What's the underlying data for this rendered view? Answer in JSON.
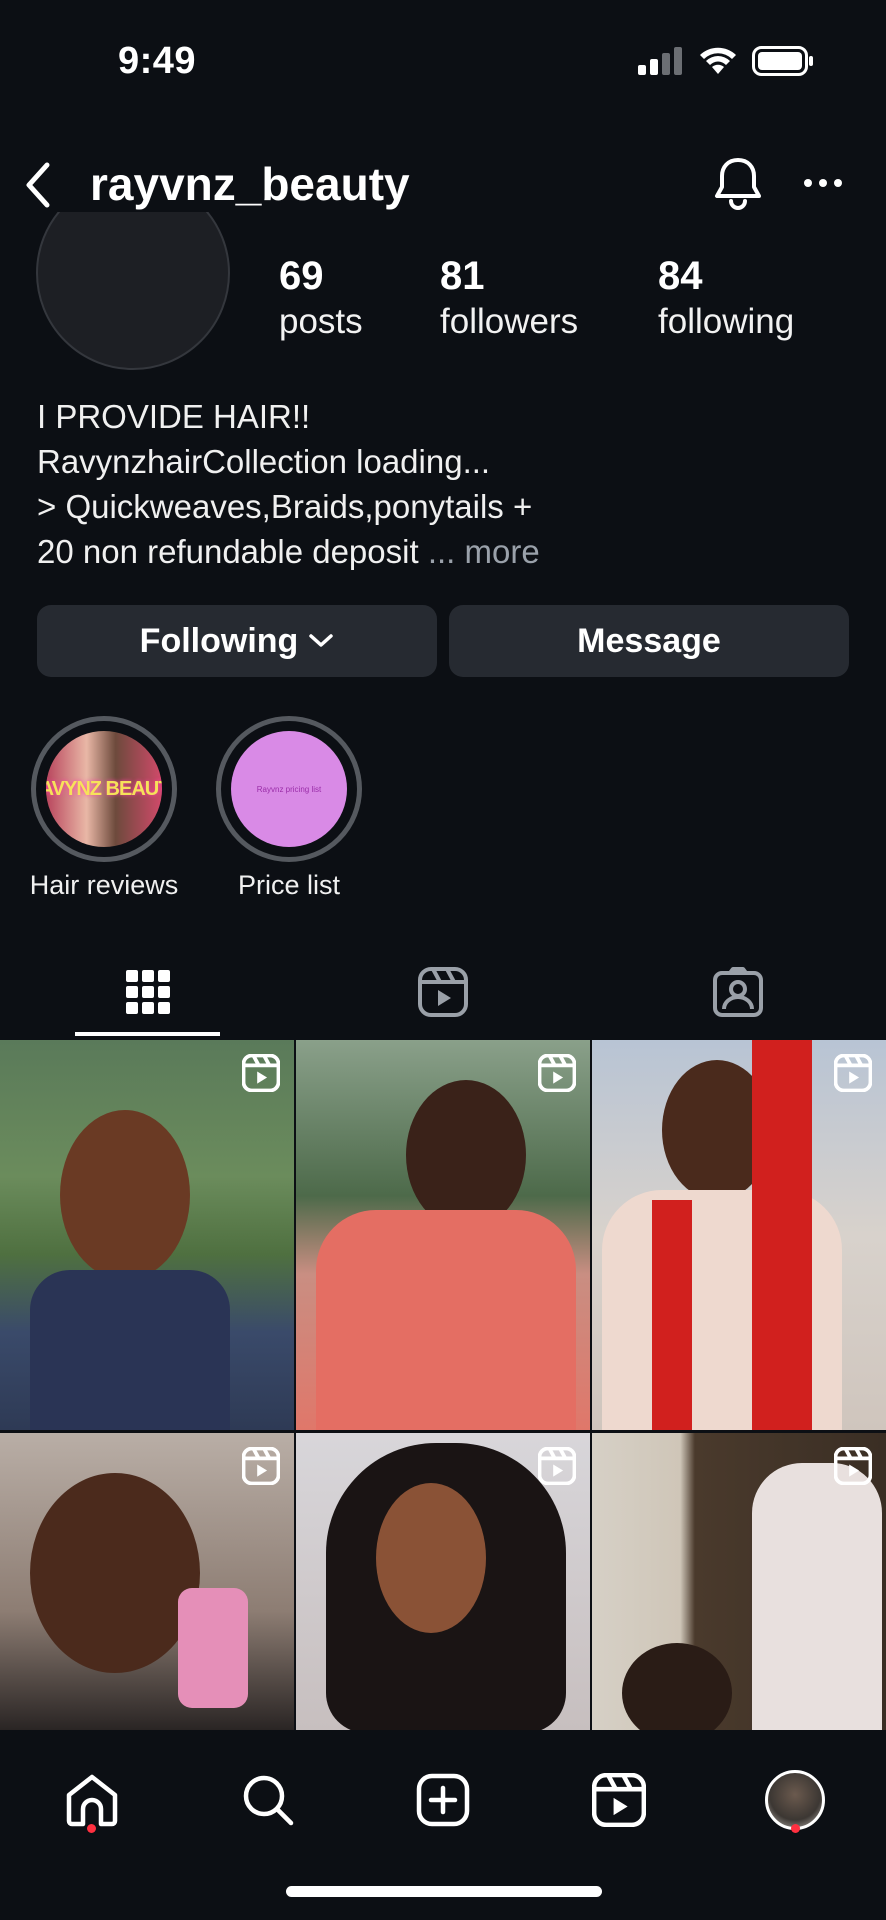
{
  "status_bar": {
    "time": "9:49"
  },
  "header": {
    "username": "rayvnz_beauty"
  },
  "profile": {
    "stats": [
      {
        "value": "69",
        "label": "posts"
      },
      {
        "value": "81",
        "label": "followers"
      },
      {
        "value": "84",
        "label": "following"
      }
    ],
    "bio_lines": [
      "I PROVIDE HAIR!!",
      "RavynzhairCollection loading...",
      "> Quickweaves,Braids,ponytails +",
      "20 non refundable deposit"
    ],
    "bio_ellipsis": "...",
    "bio_more": "more"
  },
  "actions": {
    "following_label": "Following",
    "message_label": "Message"
  },
  "highlights": [
    {
      "label": "Hair reviews",
      "cover_text": "RAVYNZ BEAUTY"
    },
    {
      "label": "Price list",
      "cover_text": "Rayvnz pricing list"
    }
  ],
  "colors": {
    "background": "#0c0f14",
    "button_bg": "#262a31",
    "notification_dot": "#ff3040",
    "price_list_cover": "#d98ae6"
  }
}
